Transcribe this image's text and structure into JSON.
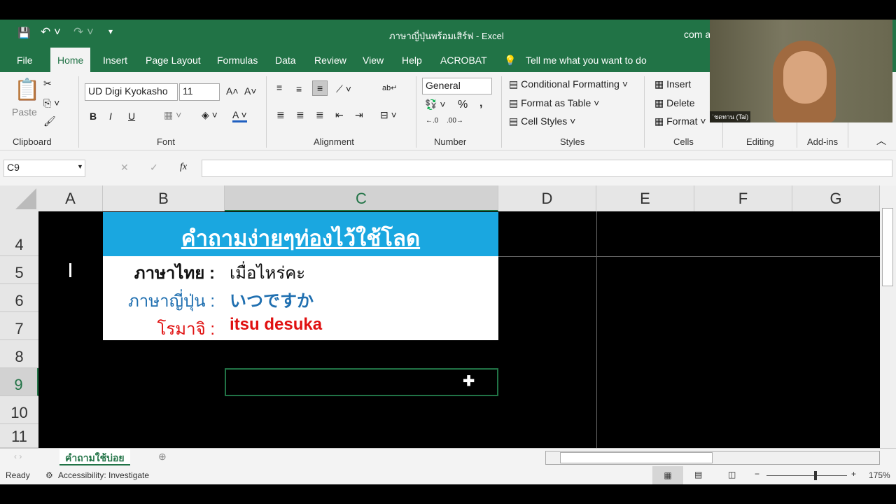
{
  "title_bar": {
    "doc_title": "ภาษาญี่ปุ่นพร้อมเสิร์ฟ  -  Excel",
    "account": "com a"
  },
  "tabs": [
    "File",
    "Home",
    "Insert",
    "Page Layout",
    "Formulas",
    "Data",
    "Review",
    "View",
    "Help",
    "ACROBAT"
  ],
  "tell_me": "Tell me what you want to do",
  "ribbon": {
    "clipboard": {
      "label": "Clipboard",
      "paste": "Paste"
    },
    "font": {
      "label": "Font",
      "name": "UD Digi Kyokasho",
      "size": "11",
      "bold": "B",
      "italic": "I",
      "underline": "U"
    },
    "alignment": {
      "label": "Alignment"
    },
    "number": {
      "label": "Number",
      "format": "General",
      "percent": "%",
      "comma": ","
    },
    "styles": {
      "label": "Styles",
      "conditional": "Conditional Formatting",
      "format_table": "Format as Table",
      "cell_styles": "Cell Styles"
    },
    "cells": {
      "label": "Cells",
      "insert": "Insert",
      "delete": "Delete",
      "format": "Format"
    },
    "editing": {
      "label": "Editing"
    },
    "addins": {
      "label": "Add-ins"
    }
  },
  "formula_bar": {
    "name_box": "C9",
    "fx": "fx",
    "value": ""
  },
  "columns": [
    "A",
    "B",
    "C",
    "D",
    "E",
    "F",
    "G"
  ],
  "rows": [
    "4",
    "5",
    "6",
    "7",
    "8",
    "9",
    "10",
    "11"
  ],
  "sheet": {
    "title": "คำถามง่ายๆท่องไว้ใช้โลด",
    "lines": [
      {
        "label": "ภาษาไทย :",
        "value": "เมื่อไหร่คะ",
        "color": "#111111"
      },
      {
        "label": "ภาษาญี่ปุ่น :",
        "value": "いつですか",
        "color": "#1f6fb0"
      },
      {
        "label": "โรมาจิ :",
        "value": "itsu desuka",
        "color": "#e01010"
      }
    ],
    "title_bg": "#1aa7e0"
  },
  "sheet_tabs": [
    "คำถามใช้บ่อย"
  ],
  "status": {
    "ready": "Ready",
    "accessibility": "Accessibility: Investigate",
    "zoom": "175%"
  },
  "webcam": {
    "caption": "ˈชดทาน (Tai)"
  }
}
